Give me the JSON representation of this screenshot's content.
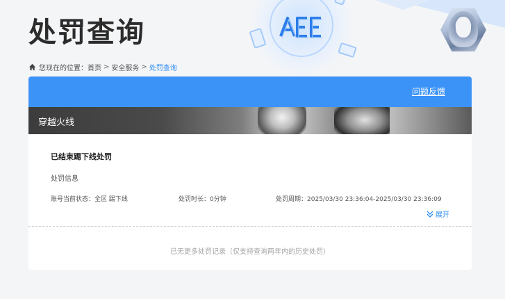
{
  "header": {
    "title": "处罚查询",
    "logo_text": "AEE"
  },
  "breadcrumb": {
    "prefix": "您现在的位置：",
    "items": [
      "首页",
      "安全服务",
      "处罚查询"
    ],
    "separator": ">"
  },
  "panel": {
    "feedback_label": "问题反馈",
    "game_name": "穿越火线"
  },
  "record": {
    "title": "已结束踢下线处罚",
    "section_label": "处罚信息",
    "fields": [
      {
        "key": "账号当前状态：",
        "value": "全区 踢下线"
      },
      {
        "key": "处罚时长：",
        "value": "0分钟"
      },
      {
        "key": "处罚周期：",
        "value": "2025/03/30 23:36:04-2025/03/30 23:36:09"
      }
    ],
    "expand_label": "展开"
  },
  "footer_note": "已无更多处罚记录（仅支持查询两年内的历史处罚）",
  "colors": {
    "accent": "#3b93f8",
    "link": "#2b8cf0",
    "background": "#f4f5f7"
  },
  "icons": {
    "home": "home-icon",
    "expand": "double-chevron-down-icon"
  }
}
